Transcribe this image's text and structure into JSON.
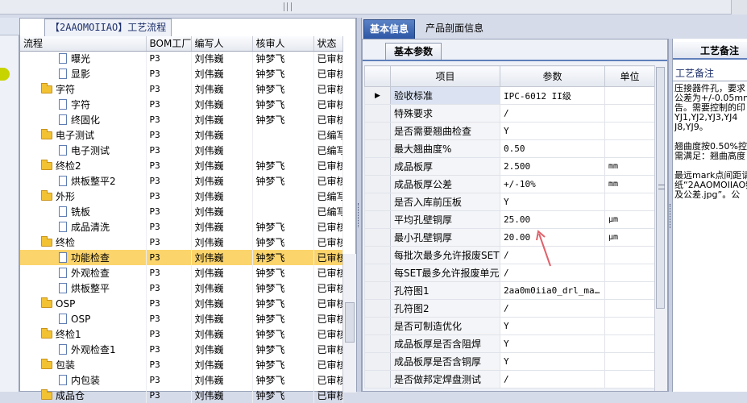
{
  "tree": {
    "tab_title": "【2AAOMOIIAO】工艺流程",
    "columns": [
      "流程",
      "BOM工厂",
      "编写人",
      "核审人",
      "状态"
    ],
    "rows": [
      {
        "level": 2,
        "kind": "doc",
        "name": "曝光",
        "bom": "P3",
        "writer": "刘伟巍",
        "reviewer": "钟梦飞",
        "status": "已审核"
      },
      {
        "level": 2,
        "kind": "doc",
        "name": "显影",
        "bom": "P3",
        "writer": "刘伟巍",
        "reviewer": "钟梦飞",
        "status": "已审核"
      },
      {
        "level": 1,
        "kind": "folder",
        "name": "字符",
        "bom": "P3",
        "writer": "刘伟巍",
        "reviewer": "钟梦飞",
        "status": "已审核"
      },
      {
        "level": 2,
        "kind": "doc",
        "name": "字符",
        "bom": "P3",
        "writer": "刘伟巍",
        "reviewer": "钟梦飞",
        "status": "已审核"
      },
      {
        "level": 2,
        "kind": "doc",
        "name": "终固化",
        "bom": "P3",
        "writer": "刘伟巍",
        "reviewer": "钟梦飞",
        "status": "已审核"
      },
      {
        "level": 1,
        "kind": "folder",
        "name": "电子测试",
        "bom": "P3",
        "writer": "刘伟巍",
        "reviewer": "",
        "status": "已编写"
      },
      {
        "level": 2,
        "kind": "doc",
        "name": "电子测试",
        "bom": "P3",
        "writer": "刘伟巍",
        "reviewer": "",
        "status": "已编写"
      },
      {
        "level": 1,
        "kind": "folder",
        "name": "终检2",
        "bom": "P3",
        "writer": "刘伟巍",
        "reviewer": "钟梦飞",
        "status": "已审核"
      },
      {
        "level": 2,
        "kind": "doc",
        "name": "烘板整平2",
        "bom": "P3",
        "writer": "刘伟巍",
        "reviewer": "钟梦飞",
        "status": "已审核"
      },
      {
        "level": 1,
        "kind": "folder",
        "name": "外形",
        "bom": "P3",
        "writer": "刘伟巍",
        "reviewer": "",
        "status": "已编写"
      },
      {
        "level": 2,
        "kind": "doc",
        "name": "铣板",
        "bom": "P3",
        "writer": "刘伟巍",
        "reviewer": "",
        "status": "已编写"
      },
      {
        "level": 2,
        "kind": "doc",
        "name": "成品清洗",
        "bom": "P3",
        "writer": "刘伟巍",
        "reviewer": "钟梦飞",
        "status": "已审核"
      },
      {
        "level": 1,
        "kind": "folder",
        "name": "终检",
        "bom": "P3",
        "writer": "刘伟巍",
        "reviewer": "钟梦飞",
        "status": "已审核"
      },
      {
        "level": 2,
        "kind": "doc",
        "name": "功能检查",
        "bom": "P3",
        "writer": "刘伟巍",
        "reviewer": "钟梦飞",
        "status": "已审核",
        "selected": true
      },
      {
        "level": 2,
        "kind": "doc",
        "name": "外观检查",
        "bom": "P3",
        "writer": "刘伟巍",
        "reviewer": "钟梦飞",
        "status": "已审核"
      },
      {
        "level": 2,
        "kind": "doc",
        "name": "烘板整平",
        "bom": "P3",
        "writer": "刘伟巍",
        "reviewer": "钟梦飞",
        "status": "已审核"
      },
      {
        "level": 1,
        "kind": "folder",
        "name": "OSP",
        "bom": "P3",
        "writer": "刘伟巍",
        "reviewer": "钟梦飞",
        "status": "已审核"
      },
      {
        "level": 2,
        "kind": "doc",
        "name": "OSP",
        "bom": "P3",
        "writer": "刘伟巍",
        "reviewer": "钟梦飞",
        "status": "已审核"
      },
      {
        "level": 1,
        "kind": "folder",
        "name": "终检1",
        "bom": "P3",
        "writer": "刘伟巍",
        "reviewer": "钟梦飞",
        "status": "已审核"
      },
      {
        "level": 2,
        "kind": "doc",
        "name": "外观检查1",
        "bom": "P3",
        "writer": "刘伟巍",
        "reviewer": "钟梦飞",
        "status": "已审核"
      },
      {
        "level": 1,
        "kind": "folder",
        "name": "包装",
        "bom": "P3",
        "writer": "刘伟巍",
        "reviewer": "钟梦飞",
        "status": "已审核"
      },
      {
        "level": 2,
        "kind": "doc",
        "name": "内包装",
        "bom": "P3",
        "writer": "刘伟巍",
        "reviewer": "钟梦飞",
        "status": "已审核"
      },
      {
        "level": 1,
        "kind": "folder",
        "name": "成品仓",
        "bom": "P3",
        "writer": "刘伟巍",
        "reviewer": "钟梦飞",
        "status": "已审核"
      }
    ]
  },
  "tabs": {
    "basic_info": "基本信息",
    "product_profile": "产品剖面信息"
  },
  "params": {
    "subtab": "基本参数",
    "columns": {
      "item": "项目",
      "param": "参数",
      "unit": "单位"
    },
    "rows": [
      {
        "item": "验收标准",
        "value": "IPC-6012 II级",
        "unit": "",
        "current": true
      },
      {
        "item": "特殊要求",
        "value": "/",
        "unit": ""
      },
      {
        "item": "是否需要翘曲检查",
        "value": "Y",
        "unit": ""
      },
      {
        "item": "最大翘曲度%",
        "value": "0.50",
        "unit": ""
      },
      {
        "item": "成品板厚",
        "value": "2.500",
        "unit": "mm"
      },
      {
        "item": "成品板厚公差",
        "value": "+/-10%",
        "unit": "mm"
      },
      {
        "item": "是否入库前压板",
        "value": "Y",
        "unit": ""
      },
      {
        "item": "平均孔壁铜厚",
        "value": "25.00",
        "unit": "μm"
      },
      {
        "item": "最小孔壁铜厚",
        "value": "20.00",
        "unit": "μm"
      },
      {
        "item": "每批次最多允许报废SET",
        "value": "/",
        "unit": ""
      },
      {
        "item": "每SET最多允许报废单元",
        "value": "/",
        "unit": ""
      },
      {
        "item": "孔符图1",
        "value": "2aa0m0iia0_drl_map...",
        "unit": ""
      },
      {
        "item": "孔符图2",
        "value": "/",
        "unit": ""
      },
      {
        "item": "是否可制造优化",
        "value": "Y",
        "unit": ""
      },
      {
        "item": "成品板厚是否含阻焊",
        "value": "Y",
        "unit": ""
      },
      {
        "item": "成品板厚是否含铜厚",
        "value": "Y",
        "unit": ""
      },
      {
        "item": "是否做邦定焊盘测试",
        "value": "/",
        "unit": ""
      }
    ]
  },
  "remark": {
    "title": "工艺备注",
    "label": "工艺备注",
    "text": "压接器件孔，要求\n公差为+/-0.05mm\n告。需要控制的印\nYJ1,YJ2,YJ3,YJ4\nJ8,YJ9。\n\n翘曲度按0.50%控\n需满足：翘曲高度\n\n最远mark点间距请\n纸“2AAOMOIIAO频\n及公差.jpg”。公"
  },
  "colors": {
    "selected_row": "#fbd46c",
    "active_tab": "#2d57a5",
    "annotation_arrow": "#e0616a"
  }
}
